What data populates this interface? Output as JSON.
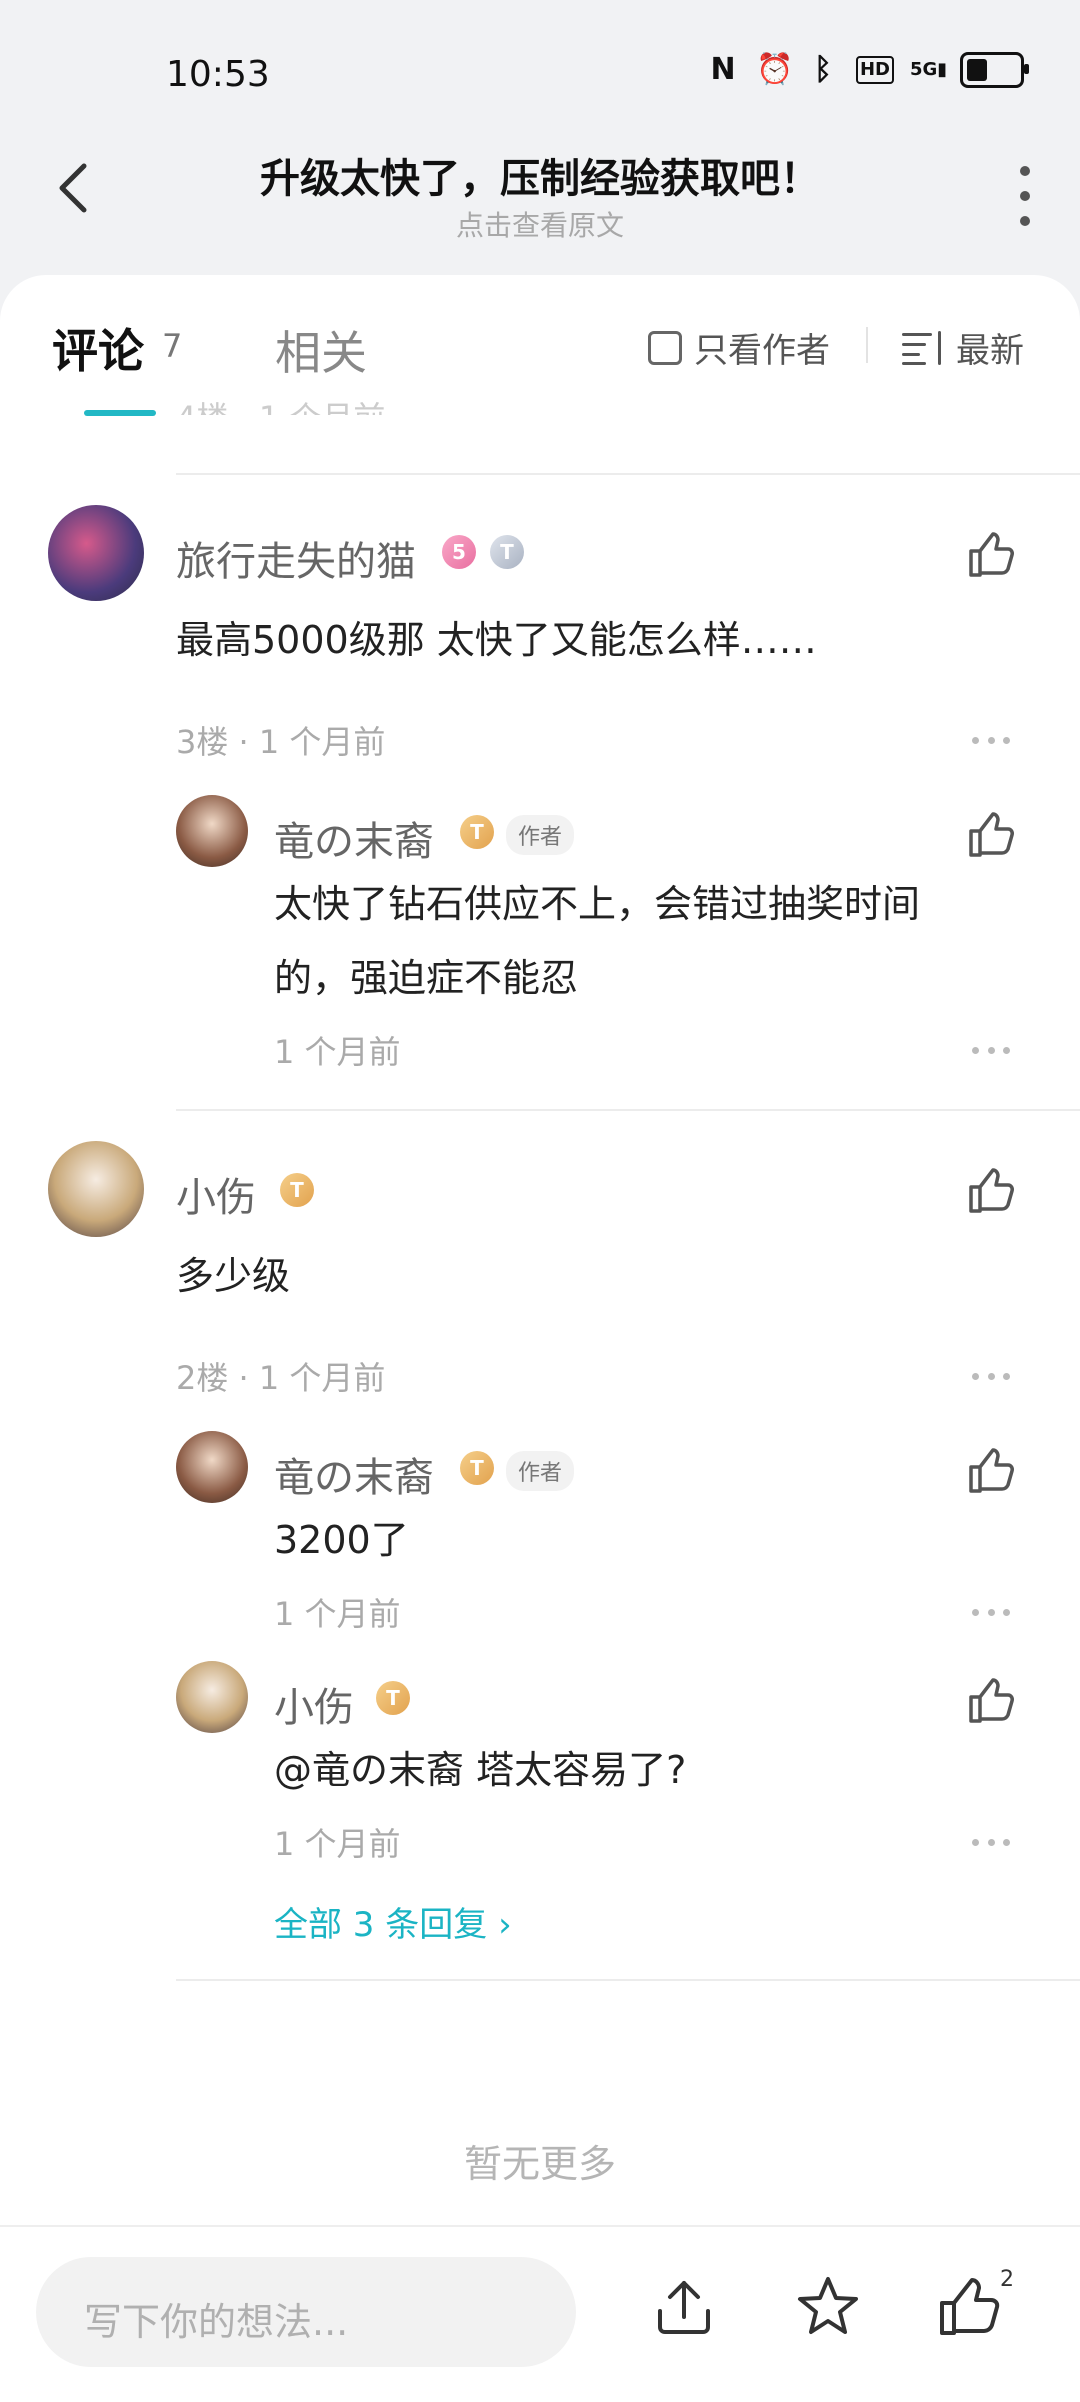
{
  "status_bar": {
    "time": "10:53",
    "battery_level_percent": 40
  },
  "header": {
    "title": "升级太快了，压制经验获取吧！",
    "subtitle": "点击查看原文"
  },
  "tabs": {
    "comments_label": "评论",
    "comments_count": "7",
    "related_label": "相关",
    "author_only_label": "只看作者",
    "sort_label": "最新"
  },
  "comments": [
    {
      "user": "旅行走失的猫",
      "badge1": "5",
      "badge2": "T",
      "text": "最高5000级那 太快了又能怎么样……",
      "floor_time": "3楼 · 1 个月前",
      "replies": [
        {
          "user": "竜の末裔",
          "badge": "T",
          "tag": "作者",
          "text_line1": "太快了钻石供应不上，会错过抽奖时间",
          "text_line2": "的，强迫症不能忍",
          "time": "1 个月前"
        }
      ]
    },
    {
      "user": "小伤",
      "badge1": "T",
      "text": "多少级",
      "floor_time": "2楼 · 1 个月前",
      "replies": [
        {
          "user": "竜の末裔",
          "badge": "T",
          "tag": "作者",
          "text": "3200了",
          "time": "1 个月前"
        },
        {
          "user": "小伤",
          "badge": "T",
          "text": "@竜の末裔  塔太容易了?",
          "time": "1 个月前"
        }
      ],
      "view_all": "全部 3 条回复"
    }
  ],
  "no_more": "暂无更多",
  "bottom_bar": {
    "input_placeholder": "写下你的想法...",
    "like_count": "2"
  }
}
